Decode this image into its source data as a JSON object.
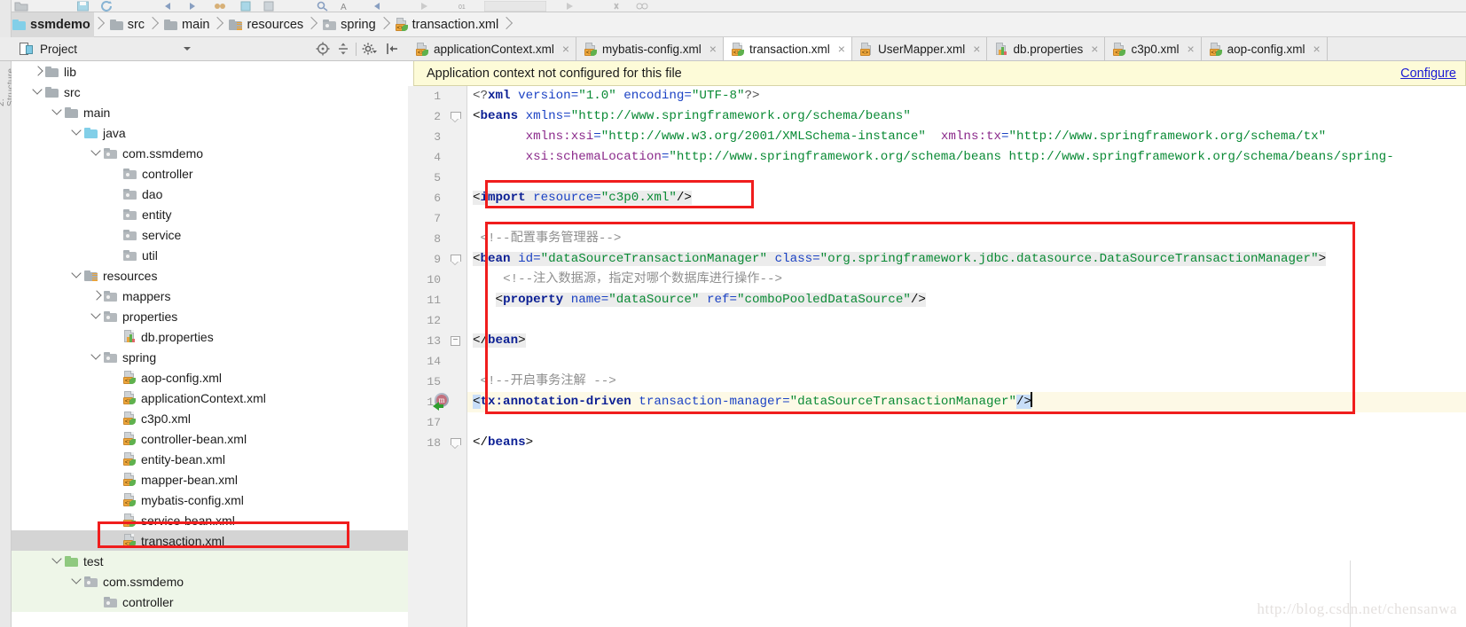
{
  "window": {
    "watermark": "http://blog.csdn.net/chensanwa"
  },
  "breadcrumb": {
    "items": [
      {
        "label": "ssmdemo",
        "icon": "module-icon"
      },
      {
        "label": "src",
        "icon": "folder-icon"
      },
      {
        "label": "main",
        "icon": "folder-icon"
      },
      {
        "label": "resources",
        "icon": "resources-folder-icon"
      },
      {
        "label": "spring",
        "icon": "package-folder-icon"
      },
      {
        "label": "transaction.xml",
        "icon": "xml-spring-file-icon"
      }
    ]
  },
  "project_panel": {
    "title": "Project",
    "dropdown_icon": "chevron-down-icon",
    "buttons": [
      {
        "name": "scroll-from-source-icon"
      },
      {
        "name": "collapse-all-icon"
      },
      {
        "name": "settings-gear-icon"
      },
      {
        "name": "hide-panel-icon"
      }
    ],
    "rail_label": "2: Structure"
  },
  "tree": [
    {
      "label": "lib",
      "indent": 1,
      "arrow": "collapsed",
      "icon": "folder",
      "bg": "none"
    },
    {
      "label": "src",
      "indent": 1,
      "arrow": "expanded",
      "icon": "folder",
      "bg": "none"
    },
    {
      "label": "main",
      "indent": 2,
      "arrow": "expanded",
      "icon": "folder",
      "bg": "none"
    },
    {
      "label": "java",
      "indent": 3,
      "arrow": "expanded",
      "icon": "java",
      "bg": "none"
    },
    {
      "label": "com.ssmdemo",
      "indent": 4,
      "arrow": "expanded",
      "icon": "pkg",
      "bg": "none"
    },
    {
      "label": "controller",
      "indent": 5,
      "arrow": "none",
      "icon": "pkg",
      "bg": "none"
    },
    {
      "label": "dao",
      "indent": 5,
      "arrow": "none",
      "icon": "pkg",
      "bg": "none"
    },
    {
      "label": "entity",
      "indent": 5,
      "arrow": "none",
      "icon": "pkg",
      "bg": "none"
    },
    {
      "label": "service",
      "indent": 5,
      "arrow": "none",
      "icon": "pkg",
      "bg": "none"
    },
    {
      "label": "util",
      "indent": 5,
      "arrow": "none",
      "icon": "pkg",
      "bg": "none"
    },
    {
      "label": "resources",
      "indent": 3,
      "arrow": "expanded",
      "icon": "res",
      "bg": "none"
    },
    {
      "label": "mappers",
      "indent": 4,
      "arrow": "collapsed",
      "icon": "pkg",
      "bg": "none"
    },
    {
      "label": "properties",
      "indent": 4,
      "arrow": "expanded",
      "icon": "pkg",
      "bg": "none"
    },
    {
      "label": "db.properties",
      "indent": 5,
      "arrow": "none",
      "icon": "propfile",
      "bg": "none"
    },
    {
      "label": "spring",
      "indent": 4,
      "arrow": "expanded",
      "icon": "pkg",
      "bg": "none"
    },
    {
      "label": "aop-config.xml",
      "indent": 5,
      "arrow": "none",
      "icon": "xml",
      "bg": "none"
    },
    {
      "label": "applicationContext.xml",
      "indent": 5,
      "arrow": "none",
      "icon": "xml",
      "bg": "none"
    },
    {
      "label": "c3p0.xml",
      "indent": 5,
      "arrow": "none",
      "icon": "xml",
      "bg": "none"
    },
    {
      "label": "controller-bean.xml",
      "indent": 5,
      "arrow": "none",
      "icon": "xml",
      "bg": "none"
    },
    {
      "label": "entity-bean.xml",
      "indent": 5,
      "arrow": "none",
      "icon": "xml",
      "bg": "none"
    },
    {
      "label": "mapper-bean.xml",
      "indent": 5,
      "arrow": "none",
      "icon": "xml",
      "bg": "none"
    },
    {
      "label": "mybatis-config.xml",
      "indent": 5,
      "arrow": "none",
      "icon": "xml",
      "bg": "none"
    },
    {
      "label": "service-bean.xml",
      "indent": 5,
      "arrow": "none",
      "icon": "xml",
      "bg": "none"
    },
    {
      "label": "transaction.xml",
      "indent": 5,
      "arrow": "none",
      "icon": "xml",
      "bg": "selected"
    },
    {
      "label": "test",
      "indent": 2,
      "arrow": "expanded",
      "icon": "test",
      "bg": "green"
    },
    {
      "label": "com.ssmdemo",
      "indent": 3,
      "arrow": "expanded",
      "icon": "pkg",
      "bg": "green"
    },
    {
      "label": "controller",
      "indent": 4,
      "arrow": "none",
      "icon": "pkg",
      "bg": "green"
    }
  ],
  "tabs": [
    {
      "label": "applicationContext.xml",
      "icon": "xml-spring-file-icon",
      "active": false,
      "close": "×"
    },
    {
      "label": "mybatis-config.xml",
      "icon": "xml-spring-file-icon",
      "active": false,
      "close": "×"
    },
    {
      "label": "transaction.xml",
      "icon": "xml-spring-file-icon",
      "active": true,
      "close": "×"
    },
    {
      "label": "UserMapper.xml",
      "icon": "xml-file-icon",
      "active": false,
      "close": "×"
    },
    {
      "label": "db.properties",
      "icon": "properties-file-icon",
      "active": false,
      "close": "×"
    },
    {
      "label": "c3p0.xml",
      "icon": "xml-spring-file-icon",
      "active": false,
      "close": "×"
    },
    {
      "label": "aop-config.xml",
      "icon": "xml-spring-file-icon",
      "active": false,
      "close": "×"
    }
  ],
  "notification": {
    "message": "Application context not configured for this file",
    "action_label": "Configure"
  },
  "editor": {
    "line_numbers": [
      "1",
      "2",
      "3",
      "4",
      "5",
      "6",
      "7",
      "8",
      "9",
      "10",
      "11",
      "12",
      "13",
      "14",
      "15",
      "16",
      "17",
      "18"
    ],
    "gutter_bean_icon_line": 16,
    "current_line": 16,
    "lines": {
      "l1_pi_open": "<?",
      "l1_pi_name": "xml",
      "l1_attr1": " version=",
      "l1_val1": "\"1.0\"",
      "l1_attr2": " encoding=",
      "l1_val2": "\"UTF-8\"",
      "l1_pi_close": "?>",
      "l2_open": "<",
      "l2_tag": "beans",
      "l2_attr": " xmlns=",
      "l2_val": "\"http://www.springframework.org/schema/beans\"",
      "l3_attr_ns": "xmlns:xsi",
      "l3_eq": "=",
      "l3_val": "\"http://www.w3.org/2001/XMLSchema-instance\"",
      "l3_attr2_ns": "xmlns:tx",
      "l3_eq2": "=",
      "l3_val2": "\"http://www.springframework.org/schema/tx\"",
      "l4_attr_ns": "xsi:schemaLocation",
      "l4_eq": "=",
      "l4_val": "\"http://www.springframework.org/schema/beans http://www.springframework.org/schema/beans/spring-",
      "l6_open": "<",
      "l6_tag": "import",
      "l6_attr": " resource=",
      "l6_val": "\"c3p0.xml\"",
      "l6_close": "/>",
      "l8_comment": "<!--配置事务管理器-->",
      "l9_open": "<",
      "l9_tag": "bean",
      "l9_attr1": " id=",
      "l9_val1": "\"dataSourceTransactionManager\"",
      "l9_attr2": " class=",
      "l9_val2": "\"org.springframework.jdbc.datasource.DataSourceTransactionManager\"",
      "l9_close": ">",
      "l10_comment": "<!--注入数据源，指定对哪个数据库进行操作-->",
      "l11_open": "<",
      "l11_tag": "property",
      "l11_attr1": " name=",
      "l11_val1": "\"dataSource\"",
      "l11_attr2": " ref=",
      "l11_val2": "\"comboPooledDataSource\"",
      "l11_close": "/>",
      "l13_open": "</",
      "l13_tag": "bean",
      "l13_close": ">",
      "l15_comment": "<!--开启事务注解 -->",
      "l16_open": "<",
      "l16_tag": "tx:annotation-driven",
      "l16_attr": " transaction-manager=",
      "l16_val": "\"dataSourceTransactionManager\"",
      "l16_close": "/>",
      "l18_open": "</",
      "l18_tag": "beans",
      "l18_close": ">"
    }
  },
  "annotations": {
    "highlight_boxes": [
      {
        "name": "import-line-highlight"
      },
      {
        "name": "transaction-config-block-highlight"
      },
      {
        "name": "transaction-file-tree-highlight"
      }
    ],
    "color": "#f01d1d"
  }
}
